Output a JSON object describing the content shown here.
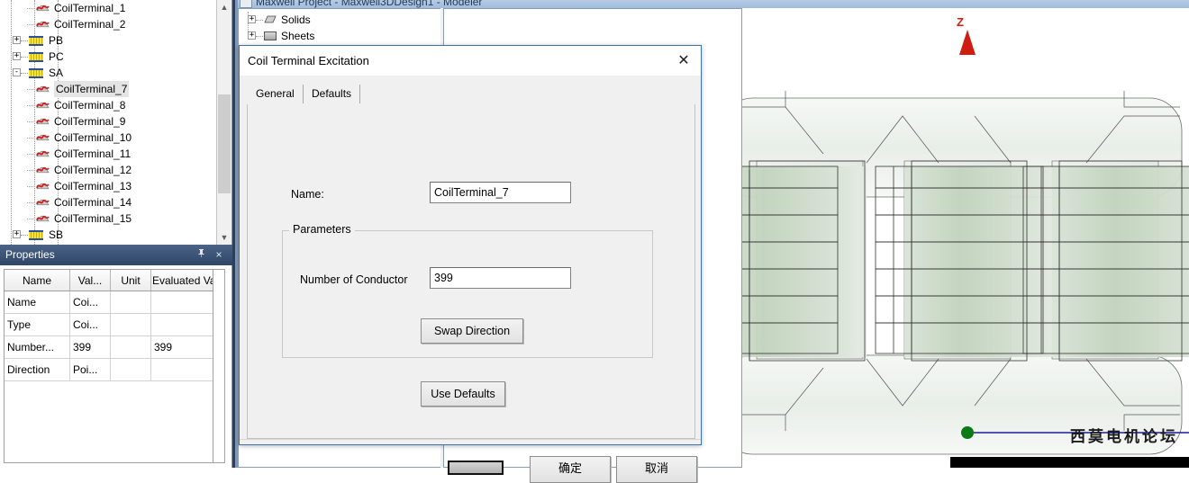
{
  "app": {
    "title": "Maxwell Project - Maxwell3DDesign1 - Modeler"
  },
  "left_panel": {
    "tree": [
      {
        "label": "CoilTerminal_1",
        "icon": "coil-terminal-icon",
        "depth": 3,
        "expander": null,
        "selected": false
      },
      {
        "label": "CoilTerminal_2",
        "icon": "coil-terminal-icon",
        "depth": 3,
        "expander": null,
        "selected": false
      },
      {
        "label": "PB",
        "icon": "winding-icon",
        "depth": 2,
        "expander": "+",
        "selected": false
      },
      {
        "label": "PC",
        "icon": "winding-icon",
        "depth": 2,
        "expander": "+",
        "selected": false
      },
      {
        "label": "SA",
        "icon": "winding-icon",
        "depth": 2,
        "expander": "-",
        "selected": false
      },
      {
        "label": "CoilTerminal_7",
        "icon": "coil-terminal-icon",
        "depth": 3,
        "expander": null,
        "selected": true
      },
      {
        "label": "CoilTerminal_8",
        "icon": "coil-terminal-icon",
        "depth": 3,
        "expander": null,
        "selected": false
      },
      {
        "label": "CoilTerminal_9",
        "icon": "coil-terminal-icon",
        "depth": 3,
        "expander": null,
        "selected": false
      },
      {
        "label": "CoilTerminal_10",
        "icon": "coil-terminal-icon",
        "depth": 3,
        "expander": null,
        "selected": false
      },
      {
        "label": "CoilTerminal_11",
        "icon": "coil-terminal-icon",
        "depth": 3,
        "expander": null,
        "selected": false
      },
      {
        "label": "CoilTerminal_12",
        "icon": "coil-terminal-icon",
        "depth": 3,
        "expander": null,
        "selected": false
      },
      {
        "label": "CoilTerminal_13",
        "icon": "coil-terminal-icon",
        "depth": 3,
        "expander": null,
        "selected": false
      },
      {
        "label": "CoilTerminal_14",
        "icon": "coil-terminal-icon",
        "depth": 3,
        "expander": null,
        "selected": false
      },
      {
        "label": "CoilTerminal_15",
        "icon": "coil-terminal-icon",
        "depth": 3,
        "expander": null,
        "selected": false
      },
      {
        "label": "SB",
        "icon": "winding-icon",
        "depth": 2,
        "expander": "+",
        "selected": false
      }
    ]
  },
  "properties": {
    "title": "Properties",
    "pin_icon": "一",
    "close_icon": "×",
    "columns": [
      "Name",
      "Val...",
      "Unit",
      "Evaluated Va..."
    ],
    "rows": [
      {
        "name": "Name",
        "value": "Coi...",
        "unit": "",
        "evaluated": ""
      },
      {
        "name": "Type",
        "value": "Coi...",
        "unit": "",
        "evaluated": ""
      },
      {
        "name": "Number...",
        "value": "399",
        "unit": "",
        "evaluated": "399"
      },
      {
        "name": "Direction",
        "value": "Poi...",
        "unit": "",
        "evaluated": ""
      }
    ]
  },
  "modeler_tree": {
    "items": [
      {
        "label": "Solids",
        "icon": "solid-icon",
        "expander": "+"
      },
      {
        "label": "Sheets",
        "icon": "sheet-icon",
        "expander": "+"
      }
    ]
  },
  "dialog": {
    "title": "Coil Terminal Excitation",
    "close_icon": "✕",
    "tabs": [
      {
        "label": "General",
        "active": true
      },
      {
        "label": "Defaults",
        "active": false
      }
    ],
    "name_label": "Name:",
    "name_value": "CoilTerminal_7",
    "parameters_legend": "Parameters",
    "conductor_label": "Number of Conductor",
    "conductor_value": "399",
    "swap_direction_label": "Swap Direction",
    "use_defaults_label": "Use Defaults",
    "ok_label": "确定",
    "cancel_label": "取消"
  },
  "viewport": {
    "axis_z_label": "Z",
    "watermark": "西莫电机论坛",
    "colors": {
      "z_axis": "#b52a1d",
      "x_axis": "#1b1b9b",
      "origin": "#0a7a14",
      "selection": "#b4443c",
      "core": "#eef2ee",
      "coil": "#c6d6c3"
    }
  }
}
